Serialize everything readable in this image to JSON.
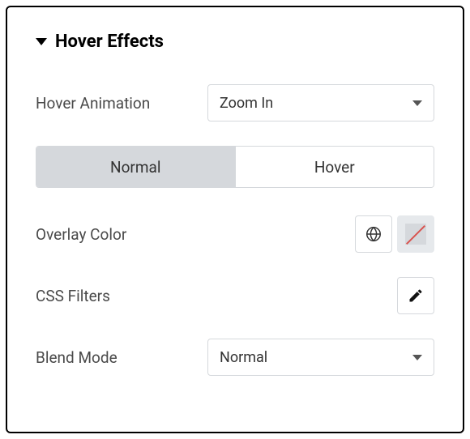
{
  "section": {
    "title": "Hover Effects"
  },
  "hover_animation": {
    "label": "Hover Animation",
    "value": "Zoom In"
  },
  "tabs": {
    "normal": "Normal",
    "hover": "Hover",
    "active": "normal"
  },
  "overlay_color": {
    "label": "Overlay Color"
  },
  "css_filters": {
    "label": "CSS Filters"
  },
  "blend_mode": {
    "label": "Blend Mode",
    "value": "Normal"
  }
}
